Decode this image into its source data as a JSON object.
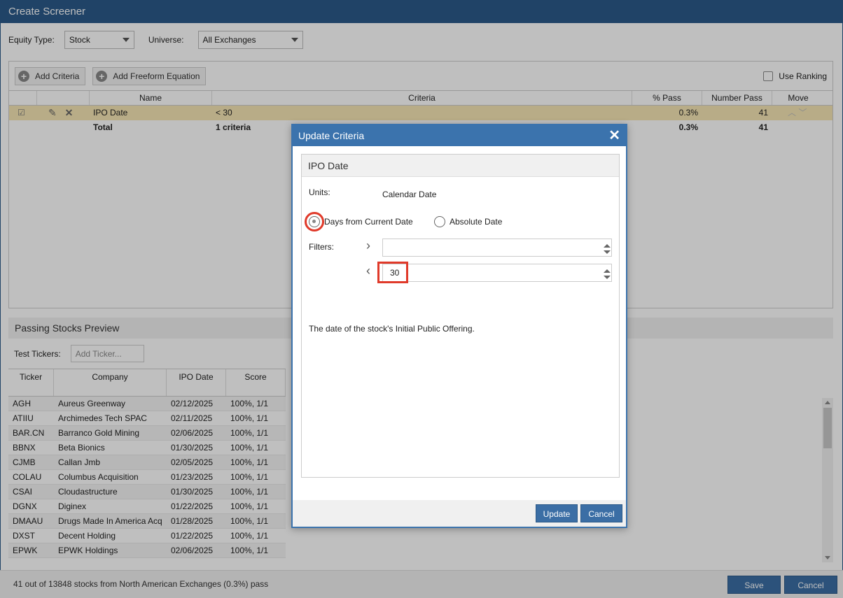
{
  "window": {
    "title": "Create Screener"
  },
  "filters": {
    "equity_type_label": "Equity Type:",
    "equity_type_value": "Stock",
    "universe_label": "Universe:",
    "universe_value": "All Exchanges"
  },
  "toolbar": {
    "add_criteria": "Add Criteria",
    "add_freeform": "Add Freeform Equation",
    "use_ranking": "Use Ranking"
  },
  "criteria_table": {
    "columns": {
      "name": "Name",
      "criteria": "Criteria",
      "pct_pass": "% Pass",
      "number_pass": "Number Pass",
      "move": "Move"
    },
    "rows": [
      {
        "name": "IPO Date",
        "criteria": "< 30",
        "pct_pass": "0.3%",
        "number_pass": "41"
      }
    ],
    "total": {
      "name": "Total",
      "criteria": "1 criteria",
      "pct_pass": "0.3%",
      "number_pass": "41"
    }
  },
  "preview": {
    "title": "Passing Stocks Preview",
    "test_tickers_label": "Test Tickers:",
    "add_ticker_placeholder": "Add Ticker...",
    "columns": {
      "ticker": "Ticker",
      "company": "Company",
      "ipo_date": "IPO Date",
      "score": "Score"
    },
    "rows": [
      {
        "ticker": "AGH",
        "company": "Aureus Greenway",
        "ipo_date": "02/12/2025",
        "score": "100%, 1/1"
      },
      {
        "ticker": "ATIIU",
        "company": "Archimedes Tech SPAC",
        "ipo_date": "02/11/2025",
        "score": "100%, 1/1"
      },
      {
        "ticker": "BAR.CN",
        "company": "Barranco Gold Mining",
        "ipo_date": "02/06/2025",
        "score": "100%, 1/1"
      },
      {
        "ticker": "BBNX",
        "company": "Beta Bionics",
        "ipo_date": "01/30/2025",
        "score": "100%, 1/1"
      },
      {
        "ticker": "CJMB",
        "company": "Callan Jmb",
        "ipo_date": "02/05/2025",
        "score": "100%, 1/1"
      },
      {
        "ticker": "COLAU",
        "company": "Columbus Acquisition",
        "ipo_date": "01/23/2025",
        "score": "100%, 1/1"
      },
      {
        "ticker": "CSAI",
        "company": "Cloudastructure",
        "ipo_date": "01/30/2025",
        "score": "100%, 1/1"
      },
      {
        "ticker": "DGNX",
        "company": "Diginex",
        "ipo_date": "01/22/2025",
        "score": "100%, 1/1"
      },
      {
        "ticker": "DMAAU",
        "company": "Drugs Made In America Acq",
        "ipo_date": "01/28/2025",
        "score": "100%, 1/1"
      },
      {
        "ticker": "DXST",
        "company": "Decent Holding",
        "ipo_date": "01/22/2025",
        "score": "100%, 1/1"
      },
      {
        "ticker": "EPWK",
        "company": "EPWK Holdings",
        "ipo_date": "02/06/2025",
        "score": "100%, 1/1"
      }
    ]
  },
  "footer": {
    "status": "41 out of 13848 stocks from North American Exchanges (0.3%) pass",
    "save": "Save",
    "cancel": "Cancel"
  },
  "modal": {
    "title": "Update Criteria",
    "close": "✕",
    "criterion_name": "IPO Date",
    "units_label": "Units:",
    "units_value": "Calendar Date",
    "radio_days": "Days from Current Date",
    "radio_absolute": "Absolute Date",
    "filters_label": "Filters:",
    "filter_gt_value": "",
    "filter_lt_value": "30",
    "description": "The date of the stock's Initial Public Offering.",
    "update": "Update",
    "cancel": "Cancel"
  }
}
